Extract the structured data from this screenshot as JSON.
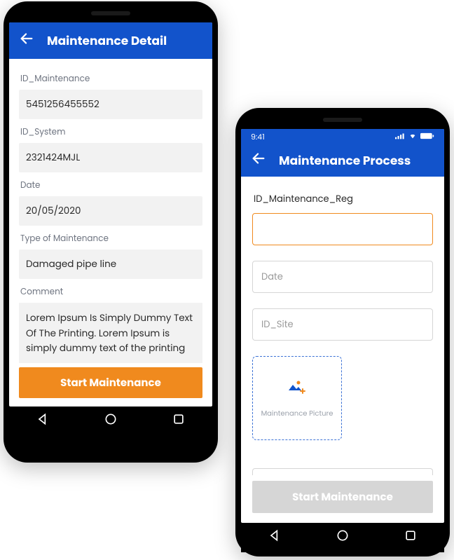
{
  "colors": {
    "brand_blue": "#1253CB",
    "accent_orange": "#F08A1E",
    "disabled": "#d6d6d6"
  },
  "phone1": {
    "header_title": "Maintenance Detail",
    "fields": {
      "id_maintenance_label": "ID_Maintenance",
      "id_maintenance_value": "5451256455552",
      "id_system_label": "ID_System",
      "id_system_value": "2321424MJL",
      "date_label": "Date",
      "date_value": "20/05/2020",
      "type_label": "Type of Maintenance",
      "type_value": "Damaged pipe line",
      "comment_label": "Comment",
      "comment_value": "Lorem Ipsum Is Simply Dummy Text Of The Printing. Lorem Ipsum is simply dummy text of the printing"
    },
    "button_label": "Start Maintenance"
  },
  "phone2": {
    "status_time": "9:41",
    "header_title": "Maintenance Process",
    "fields": {
      "id_reg_label": "ID_Maintenance_Reg",
      "id_reg_value": "",
      "date_placeholder": "Date",
      "id_site_placeholder": "ID_Site"
    },
    "upload_caption": "Maintenance Picture",
    "button_label": "Start Maintenance"
  }
}
